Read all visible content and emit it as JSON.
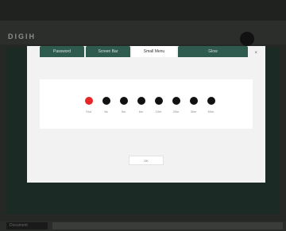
{
  "background": {
    "brand": "DIGIH",
    "bottombar_left": "Document"
  },
  "modal": {
    "tabs": [
      {
        "label": "Password"
      },
      {
        "label": "Screen Bar"
      },
      {
        "label": "Small Menu",
        "active": true
      },
      {
        "label": "Glow"
      }
    ],
    "close_label": "×",
    "ok_label": "OK",
    "options": [
      {
        "label": "Slot",
        "active": true
      },
      {
        "label": "8s"
      },
      {
        "label": "5m"
      },
      {
        "label": "6m"
      },
      {
        "label": "10m"
      },
      {
        "label": "20m"
      },
      {
        "label": "30m"
      },
      {
        "label": "60m"
      }
    ]
  },
  "colors": {
    "accent_red": "#e52526",
    "tab_green": "#2f5a4e",
    "dot_black": "#111111"
  }
}
